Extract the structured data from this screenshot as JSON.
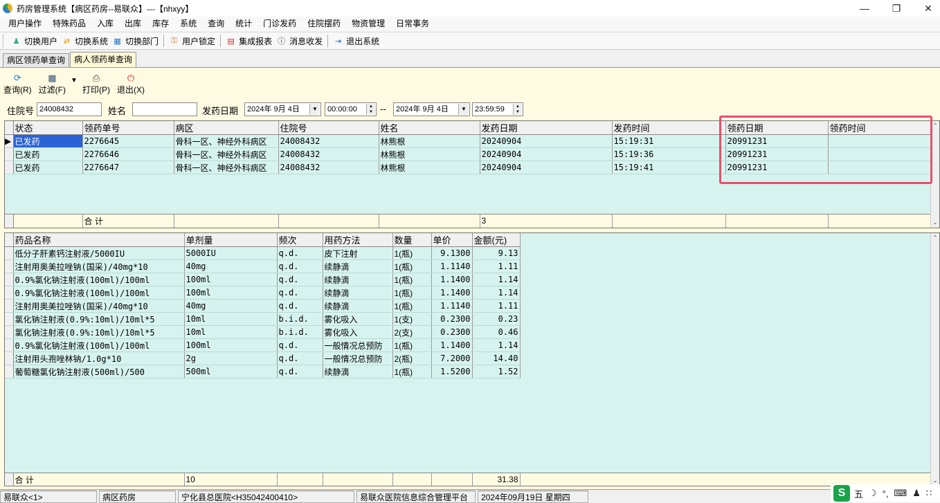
{
  "window": {
    "title": "药房管理系统【病区药房--易联众】---【nhxyy】"
  },
  "menu": [
    "用户操作",
    "特殊药品",
    "入库",
    "出库",
    "库存",
    "系统",
    "查询",
    "统计",
    "门诊发药",
    "住院摆药",
    "物资管理",
    "日常事务"
  ],
  "toolbar": [
    {
      "label": "切换用户",
      "icon": "switch-user-icon"
    },
    {
      "label": "切换系统",
      "icon": "switch-system-icon"
    },
    {
      "label": "切换部门",
      "icon": "switch-dept-icon"
    },
    {
      "label": "用户锁定",
      "icon": "user-lock-icon"
    },
    {
      "label": "集成报表",
      "icon": "report-icon"
    },
    {
      "label": "消息收发",
      "icon": "message-icon"
    },
    {
      "label": "退出系统",
      "icon": "exit-system-icon"
    }
  ],
  "tabs": [
    {
      "label": "病区领药单查询",
      "active": false
    },
    {
      "label": "病人领药单查询",
      "active": true
    }
  ],
  "actions": [
    {
      "label": "查询(R)",
      "icon": "query-icon"
    },
    {
      "label": "过滤(F)",
      "icon": "filter-icon"
    },
    {
      "label": "打印(P)",
      "icon": "print-icon"
    },
    {
      "label": "退出(X)",
      "icon": "power-icon"
    }
  ],
  "filter": {
    "inpatient_label": "住院号",
    "inpatient_value": "24008432",
    "name_label": "姓名",
    "name_value": "",
    "dispense_date_label": "发药日期",
    "date_from": "2024年 9月 4日",
    "time_from": "00:00:00",
    "range_sep": "--",
    "date_to": "2024年 9月 4日",
    "time_to": "23:59:59"
  },
  "orders": {
    "columns": [
      "状态",
      "领药单号",
      "病区",
      "住院号",
      "姓名",
      "发药日期",
      "发药时间",
      "领药日期",
      "领药时间"
    ],
    "rows": [
      [
        "已发药",
        "2276645",
        "骨科一区、神经外科病区",
        "24008432",
        "林熊根",
        "20240904",
        "15:19:31",
        "20991231",
        ""
      ],
      [
        "已发药",
        "2276646",
        "骨科一区、神经外科病区",
        "24008432",
        "林熊根",
        "20240904",
        "15:19:36",
        "20991231",
        ""
      ],
      [
        "已发药",
        "2276647",
        "骨科一区、神经外科病区",
        "24008432",
        "林熊根",
        "20240904",
        "15:19:41",
        "20991231",
        ""
      ]
    ],
    "footer": {
      "label": "合  计",
      "count": "3"
    }
  },
  "drugs": {
    "columns": [
      "药品名称",
      "单剂量",
      "频次",
      "用药方法",
      "数量",
      "单价",
      "金额(元)"
    ],
    "rows": [
      [
        "低分子肝素钙注射液/5000IU",
        "5000IU",
        "q.d.",
        "皮下注射",
        "1(瓶)",
        "9.1300",
        "9.13"
      ],
      [
        "注射用奥美拉唑钠(国采)/40mg*10",
        "40mg",
        "q.d.",
        "续静滴",
        "1(瓶)",
        "1.1140",
        "1.11"
      ],
      [
        "0.9%氯化钠注射液(100ml)/100ml",
        "100ml",
        "q.d.",
        "续静滴",
        "1(瓶)",
        "1.1400",
        "1.14"
      ],
      [
        "0.9%氯化钠注射液(100ml)/100ml",
        "100ml",
        "q.d.",
        "续静滴",
        "1(瓶)",
        "1.1400",
        "1.14"
      ],
      [
        "注射用奥美拉唑钠(国采)/40mg*10",
        "40mg",
        "q.d.",
        "续静滴",
        "1(瓶)",
        "1.1140",
        "1.11"
      ],
      [
        "氯化钠注射液(0.9%:10ml)/10ml*5",
        "10ml",
        "b.i.d.",
        "雾化吸入",
        "1(支)",
        "0.2300",
        "0.23"
      ],
      [
        "氯化钠注射液(0.9%:10ml)/10ml*5",
        "10ml",
        "b.i.d.",
        "雾化吸入",
        "2(支)",
        "0.2300",
        "0.46"
      ],
      [
        "0.9%氯化钠注射液(100ml)/100ml",
        "100ml",
        "q.d.",
        "一般情况总预防",
        "1(瓶)",
        "1.1400",
        "1.14"
      ],
      [
        "注射用头孢唑林钠/1.0g*10",
        "2g",
        "q.d.",
        "一般情况总预防",
        "2(瓶)",
        "7.2000",
        "14.40"
      ],
      [
        "葡萄糖氯化钠注射液(500ml)/500",
        "500ml",
        "q.d.",
        "续静滴",
        "1(瓶)",
        "1.5200",
        "1.52"
      ]
    ],
    "footer": {
      "label": "合  计",
      "dose_total": "10",
      "amount_total": "31.38"
    }
  },
  "status": [
    "易联众<1>",
    "病区药房",
    "宁化县总医院<H35042400410>",
    "易联众医院信息综合管理平台",
    "2024年09月19日 星期四"
  ],
  "ime": {
    "logo": "S",
    "mode": "五"
  },
  "colors": {
    "highlight": "#e6506a",
    "grid_bg": "#d7f3ef",
    "panel_bg": "#fffbe3",
    "selection": "#2b63d6"
  }
}
